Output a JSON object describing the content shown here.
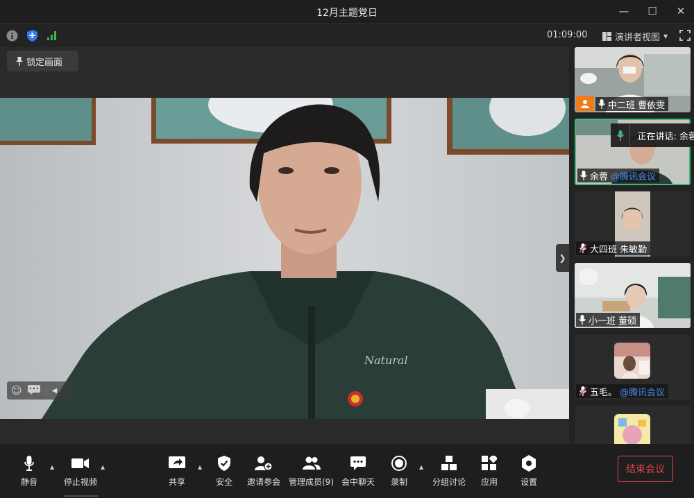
{
  "window": {
    "title": "12月主题党日",
    "minimize": "—",
    "maximize": "☐",
    "close": "✕"
  },
  "infobar": {
    "timer": "01:09:00",
    "view_mode": "演讲者视图"
  },
  "stage": {
    "lock_label": "锁定画面"
  },
  "speaking": {
    "label": "正在讲话: 余蓉"
  },
  "participants": [
    {
      "name": "中二班 曹依雯",
      "suffix": "",
      "muted": false,
      "tag": true
    },
    {
      "name": "余蓉",
      "suffix": "@腾讯会议",
      "muted": false,
      "active": true
    },
    {
      "name": "大四班 朱敏勤",
      "suffix": "",
      "muted": true
    },
    {
      "name": "小一班 董硕",
      "suffix": "",
      "muted": false
    },
    {
      "name": "五毛。",
      "suffix": "@腾讯会议",
      "muted": true
    },
    {
      "name": "",
      "suffix": "",
      "muted": false
    }
  ],
  "toolbar": {
    "mute": "静音",
    "stop_video": "停止视频",
    "share": "共享",
    "security": "安全",
    "invite": "邀请参会",
    "members": "管理成员(9)",
    "chat": "会中聊天",
    "record": "录制",
    "breakout": "分组讨论",
    "apps": "应用",
    "settings": "设置",
    "end": "结束会议"
  },
  "colors": {
    "end_red": "#e0474c",
    "active_green": "#3cb878",
    "link_blue": "#4a8cf7",
    "signal_green": "#2fbf4a",
    "shield_blue": "#2f7cf6"
  }
}
